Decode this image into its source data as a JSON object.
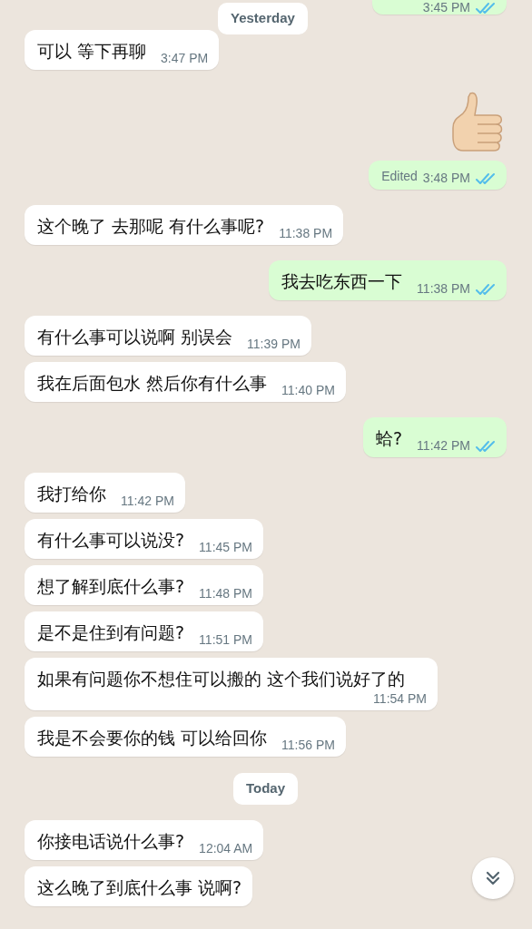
{
  "messages": [
    {
      "kind": "out",
      "time": "3:45 PM",
      "read": true,
      "cut_top": true
    },
    {
      "kind": "date",
      "text": "Yesterday",
      "floating": true
    },
    {
      "kind": "in",
      "text": "可以 等下再聊",
      "time": "3:47 PM"
    },
    {
      "kind": "emoji"
    },
    {
      "kind": "out",
      "label": "Edited",
      "time": "3:48 PM",
      "read": true
    },
    {
      "kind": "in",
      "text": "这个晚了 去那呢 有什么事呢?",
      "time": "11:38 PM"
    },
    {
      "kind": "out",
      "text": "我去吃东西一下",
      "time": "11:38 PM",
      "read": true
    },
    {
      "kind": "in",
      "text": "有什么事可以说啊 别误会",
      "time": "11:39 PM"
    },
    {
      "kind": "in",
      "text": "我在后面包水 然后你有什么事",
      "time": "11:40 PM"
    },
    {
      "kind": "out",
      "text": "蛤?",
      "time": "11:42 PM",
      "read": true
    },
    {
      "kind": "in",
      "text": "我打给你",
      "time": "11:42 PM"
    },
    {
      "kind": "in",
      "text": "有什么事可以说没?",
      "time": "11:45 PM"
    },
    {
      "kind": "in",
      "text": "想了解到底什么事?",
      "time": "11:48 PM"
    },
    {
      "kind": "in",
      "text": "是不是住到有问题?",
      "time": "11:51 PM"
    },
    {
      "kind": "in",
      "text": "如果有问题你不想住可以搬的 这个我们说好了的",
      "time": "11:54 PM"
    },
    {
      "kind": "in",
      "text": "我是不会要你的钱 可以给回你",
      "time": "11:56 PM"
    },
    {
      "kind": "date",
      "text": "Today"
    },
    {
      "kind": "in",
      "text": "你接电话说什么事?",
      "time": "12:04 AM"
    },
    {
      "kind": "in",
      "text": "这么晚了到底什么事 说啊?"
    }
  ]
}
